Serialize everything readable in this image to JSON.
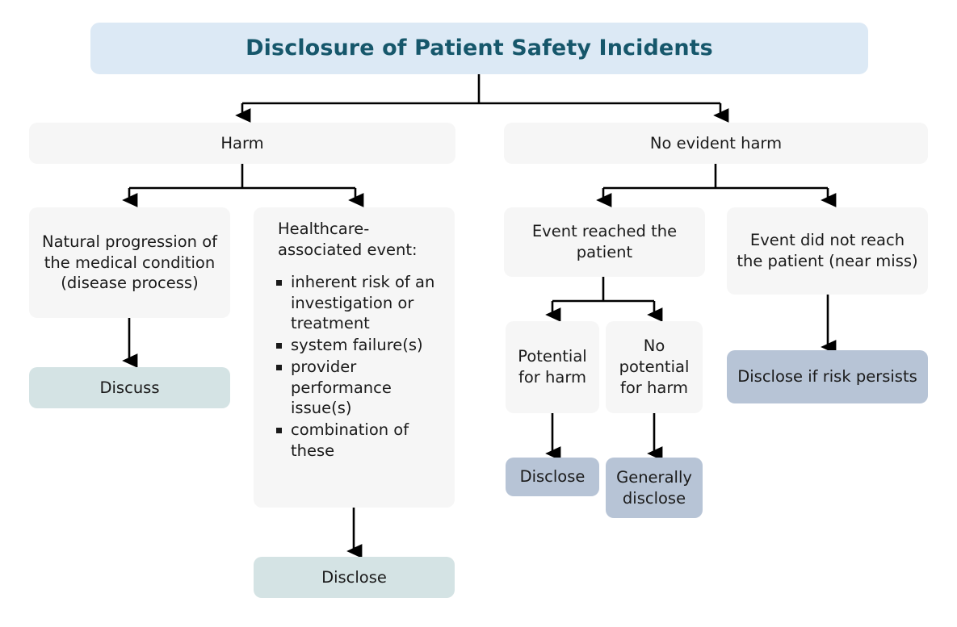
{
  "diagram": {
    "title": "Disclosure of Patient Safety Incidents",
    "colors": {
      "title_bg": "#dce9f5",
      "title_text": "#16576b",
      "neutral_bg": "#f6f6f6",
      "teal_bg": "#d4e3e4",
      "blue_bg": "#b7c4d6",
      "connector": "#000000",
      "text": "#1a1a1a"
    },
    "nodes": {
      "harm": "Harm",
      "no_evident_harm": "No evident harm",
      "natural_progression": "Natural progression of the medical condition (disease process)",
      "healthcare_event_lead": "Healthcare-associated event:",
      "healthcare_event_items": [
        "inherent risk of an investigation or treatment",
        "system failure(s)",
        "provider performance issue(s)",
        "combination of these"
      ],
      "discuss": "Discuss",
      "disclose_left": "Disclose",
      "event_reached": "Event reached the patient",
      "event_not_reached": "Event did not reach the patient (near miss)",
      "potential_for_harm": "Potential for harm",
      "no_potential_for_harm": "No potential for harm",
      "disclose_right": "Disclose",
      "generally_disclose": "Generally disclose",
      "disclose_if_risk_persists": "Disclose if risk persists"
    }
  }
}
